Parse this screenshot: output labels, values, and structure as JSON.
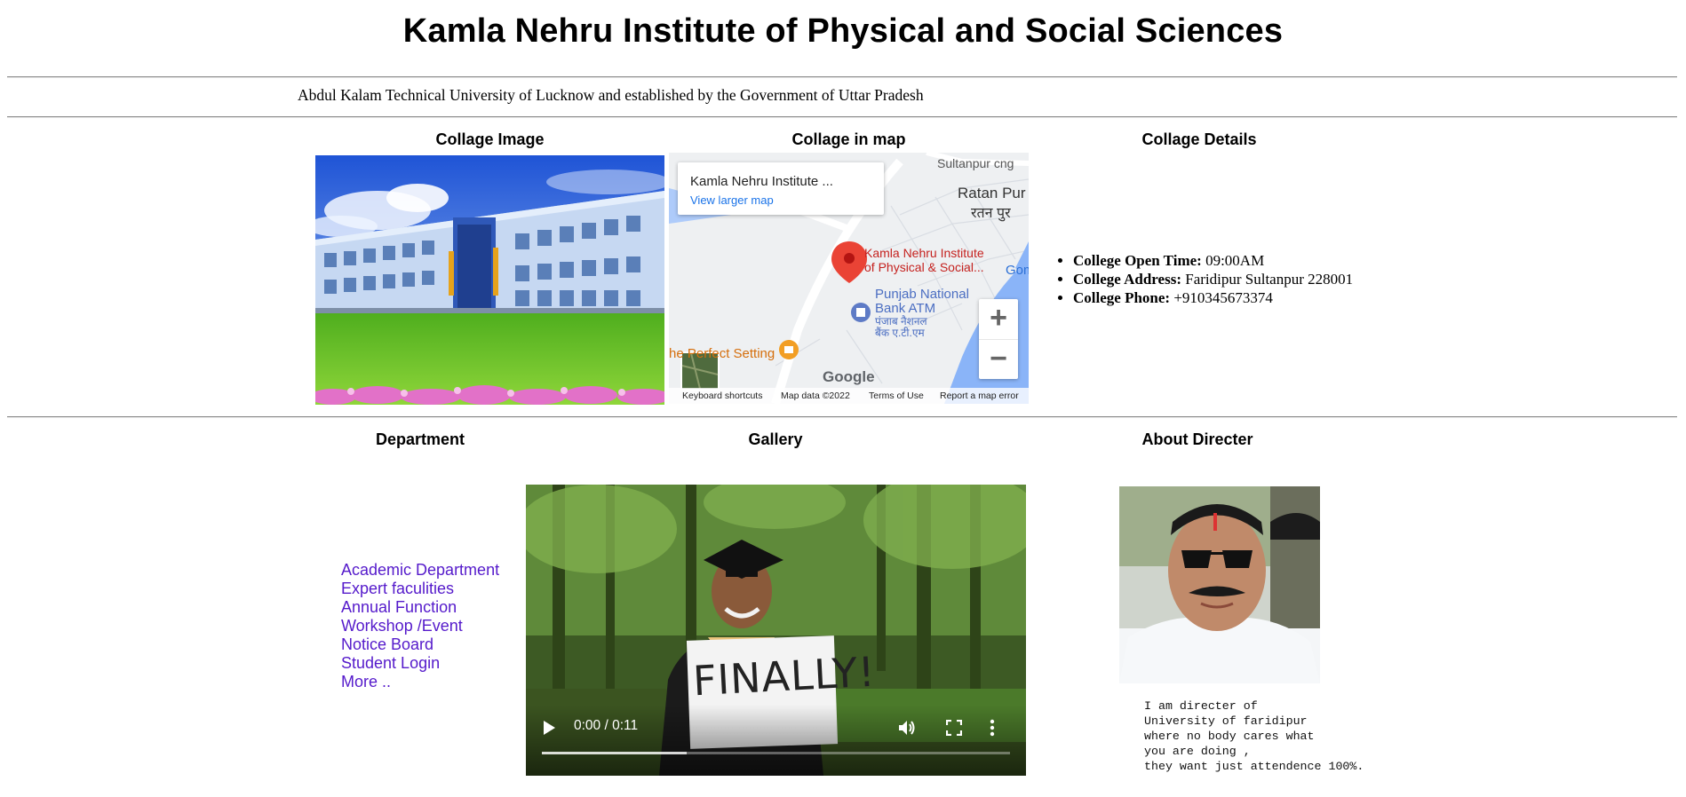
{
  "header": {
    "title": "Kamla Nehru Institute of Physical and Social Sciences",
    "subtitle": "Abdul Kalam Technical University of Lucknow and established by the Government of Uttar Pradesh"
  },
  "row1": {
    "image_heading": "Collage Image",
    "map_heading": "Collage in map",
    "details_heading": "Collage Details"
  },
  "map": {
    "place_name": "Kamla Nehru Institute ...",
    "larger_map_link": "View larger map",
    "pin_label_line1": "Kamla Nehru Institute",
    "pin_label_line2": "of Physical & Social...",
    "label_sultanpur": "Sultanpur cng",
    "label_ratan_pur_en": "Ratan Pur",
    "label_ratan_pur_hi": "रतन पुर",
    "label_bank_line1": "Punjab National",
    "label_bank_line2": "Bank ATM",
    "label_bank_hi_line1": "पंजाब नैशनल",
    "label_bank_hi_line2": "बैंक ए.टी.एम",
    "label_setting": "he Perfect Setting",
    "label_gom": "Gom",
    "google_logo": "Google",
    "footer_shortcuts": "Keyboard shortcuts",
    "footer_data": "Map data ©2022",
    "footer_terms": "Terms of Use",
    "footer_report": "Report a map error",
    "zoom_in": "+",
    "zoom_out": "−",
    "colors": {
      "road": "#ffffff",
      "water": "#8ab4f8",
      "pin": "#ea4335",
      "poi_blue": "#5e7bc6",
      "poi_orange": "#f29e24"
    }
  },
  "details": {
    "open_time_label": "College Open Time:",
    "open_time_value": " 09:00AM",
    "address_label": "College Address:",
    "address_value": " Faridipur Sultanpur 228001",
    "phone_label": "College Phone:",
    "phone_value": " +910345673374"
  },
  "row2": {
    "department_heading": "Department",
    "gallery_heading": "Gallery",
    "director_heading": "About Directer"
  },
  "department_links": [
    "Academic Department",
    "Expert faculities",
    "Annual Function",
    "Workshop /Event",
    "Notice Board",
    "Student Login",
    "More .."
  ],
  "video": {
    "sign_text": "FINALLY!",
    "time_display": "0:00 / 0:11",
    "controls": [
      "play-icon",
      "volume-icon",
      "fullscreen-icon",
      "more-options-icon"
    ]
  },
  "director": {
    "bio": "I am directer of\nUniversity of faridipur\nwhere no body cares what\nyou are doing ,\nthey want just attendence 100%."
  },
  "colors": {
    "link": "#551acb",
    "rule": "#8a8a8a",
    "lawn": "#6cc52a",
    "sky": "#2b63d9"
  }
}
